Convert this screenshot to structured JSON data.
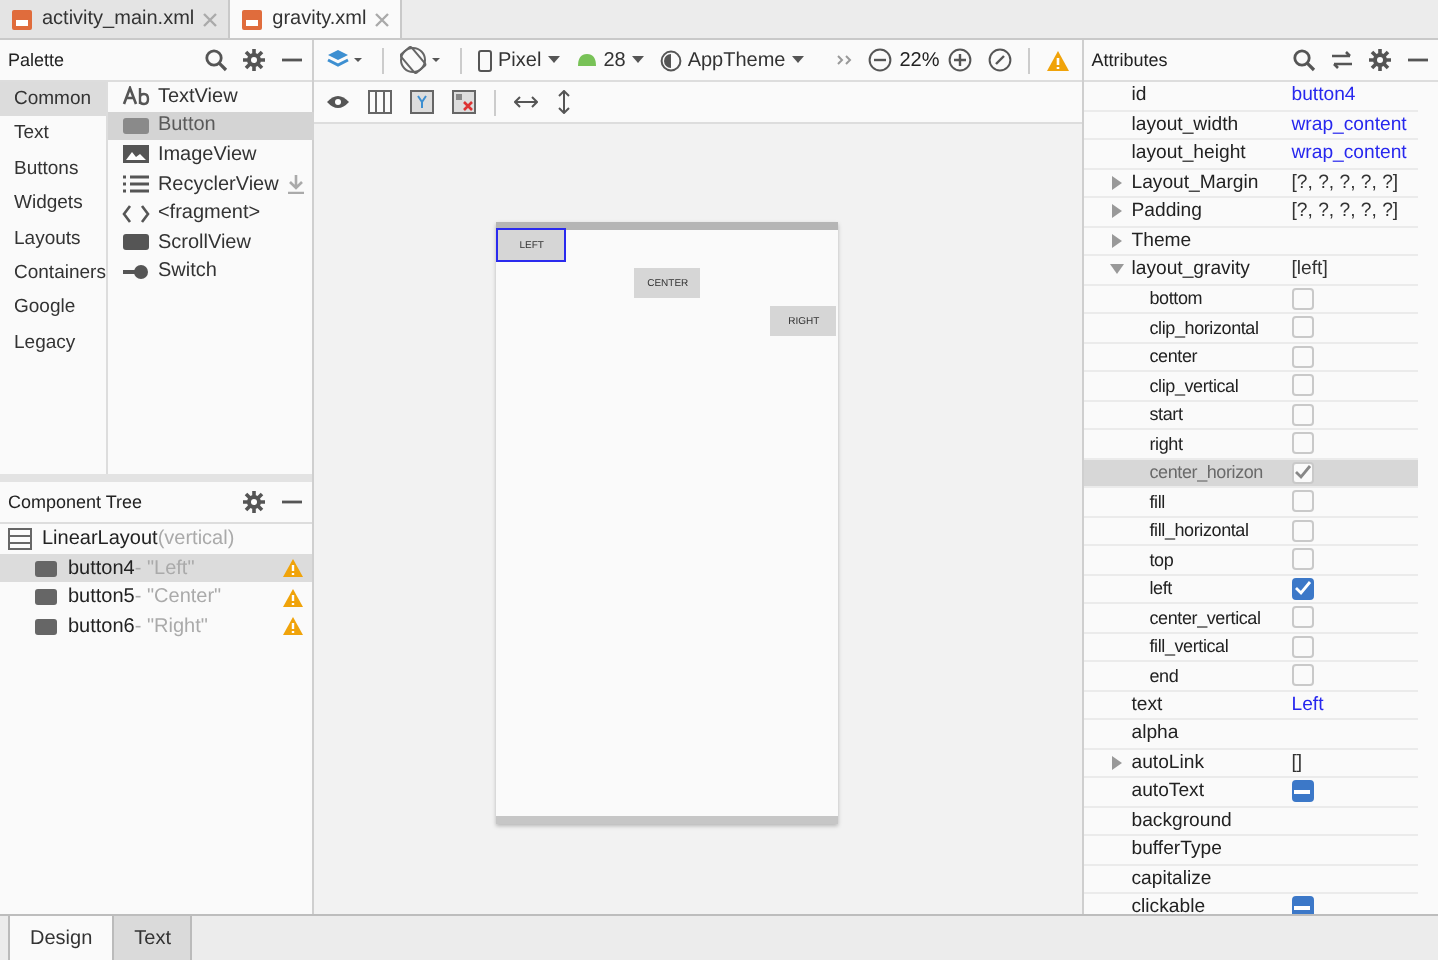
{
  "editor_tabs": [
    {
      "label": "activity_main.xml",
      "selected": false
    },
    {
      "label": "gravity.xml",
      "selected": true
    }
  ],
  "palette": {
    "title": "Palette",
    "categories": [
      {
        "label": "Common",
        "selected": true
      },
      {
        "label": "Text",
        "selected": false
      },
      {
        "label": "Buttons",
        "selected": false
      },
      {
        "label": "Widgets",
        "selected": false
      },
      {
        "label": "Layouts",
        "selected": false
      },
      {
        "label": "Containers",
        "selected": false
      },
      {
        "label": "Google",
        "selected": false
      },
      {
        "label": "Legacy",
        "selected": false
      }
    ],
    "items": [
      {
        "label": "TextView",
        "kind": "ab",
        "selected": false,
        "download": false
      },
      {
        "label": "Button",
        "kind": "button",
        "selected": true,
        "download": false
      },
      {
        "label": "ImageView",
        "kind": "image",
        "selected": false,
        "download": false
      },
      {
        "label": "RecyclerView",
        "kind": "list",
        "selected": false,
        "download": true
      },
      {
        "label": "<fragment>",
        "kind": "code",
        "selected": false,
        "download": false
      },
      {
        "label": "ScrollView",
        "kind": "button",
        "selected": false,
        "download": false
      },
      {
        "label": "Switch",
        "kind": "switch",
        "selected": false,
        "download": false
      }
    ]
  },
  "component_tree": {
    "title": "Component Tree",
    "root": {
      "label": "LinearLayout",
      "note": "(vertical)",
      "children": [
        {
          "label": "button4",
          "note": "- \"Left\"",
          "warning": true,
          "selected": true
        },
        {
          "label": "button5",
          "note": "- \"Center\"",
          "warning": true,
          "selected": false
        },
        {
          "label": "button6",
          "note": "- \"Right\"",
          "warning": true,
          "selected": false
        }
      ]
    }
  },
  "toolbar": {
    "device": "Pixel",
    "api": "28",
    "theme": "AppTheme",
    "zoom": "22%",
    "warning": true
  },
  "canvas": {
    "buttons": [
      {
        "label": "LEFT",
        "kind": "left",
        "selected": true
      },
      {
        "label": "CENTER",
        "kind": "center",
        "selected": false
      },
      {
        "label": "RIGHT",
        "kind": "right",
        "selected": false
      }
    ]
  },
  "attributes": {
    "title": "Attributes",
    "rows": [
      {
        "kind": "value",
        "name": "id",
        "value": "button4",
        "link": true,
        "selected": false
      },
      {
        "kind": "value",
        "name": "layout_width",
        "value": "wrap_content",
        "link": true,
        "selected": false
      },
      {
        "kind": "value",
        "name": "layout_height",
        "value": "wrap_content",
        "link": true,
        "selected": false
      },
      {
        "kind": "group",
        "name": "Layout_Margin",
        "value": "[?, ?, ?, ?, ?]",
        "expanded": false,
        "selected": false
      },
      {
        "kind": "group",
        "name": "Padding",
        "value": "[?, ?, ?, ?, ?]",
        "expanded": false,
        "selected": false
      },
      {
        "kind": "group",
        "name": "Theme",
        "expanded": false,
        "selected": false
      },
      {
        "kind": "group",
        "name": "layout_gravity",
        "value": "[left]",
        "expanded": true,
        "selected": false,
        "children": [
          {
            "kind": "flag",
            "name": "bottom",
            "checked": false,
            "selected": false
          },
          {
            "kind": "flag",
            "name": "clip_horizontal",
            "checked": false,
            "selected": false
          },
          {
            "kind": "flag",
            "name": "center",
            "checked": false,
            "selected": false
          },
          {
            "kind": "flag",
            "name": "clip_vertical",
            "checked": false,
            "selected": false
          },
          {
            "kind": "flag",
            "name": "start",
            "checked": false,
            "selected": false
          },
          {
            "kind": "flag",
            "name": "right",
            "checked": false,
            "selected": false
          },
          {
            "kind": "flag",
            "name": "center_horizon",
            "checked": true,
            "selected": true
          },
          {
            "kind": "flag",
            "name": "fill",
            "checked": false,
            "selected": false
          },
          {
            "kind": "flag",
            "name": "fill_horizontal",
            "checked": false,
            "selected": false
          },
          {
            "kind": "flag",
            "name": "top",
            "checked": false,
            "selected": false
          },
          {
            "kind": "flag",
            "name": "left",
            "checked": true,
            "selected": false
          },
          {
            "kind": "flag",
            "name": "center_vertical",
            "checked": false,
            "selected": false
          },
          {
            "kind": "flag",
            "name": "fill_vertical",
            "checked": false,
            "selected": false
          },
          {
            "kind": "flag",
            "name": "end",
            "checked": false,
            "selected": false
          }
        ]
      },
      {
        "kind": "value",
        "name": "text",
        "value": "Left",
        "link": true,
        "selected": false
      },
      {
        "kind": "value",
        "name": "alpha",
        "selected": false
      },
      {
        "kind": "group",
        "name": "autoLink",
        "value": "[]",
        "expanded": false,
        "selected": false
      },
      {
        "kind": "tristate",
        "name": "autoText",
        "mixed": true,
        "selected": false
      },
      {
        "kind": "value",
        "name": "background",
        "selected": false
      },
      {
        "kind": "value",
        "name": "bufferType",
        "selected": false
      },
      {
        "kind": "value",
        "name": "capitalize",
        "selected": false
      },
      {
        "kind": "tristate",
        "name": "clickable",
        "mixed": true,
        "selected": false
      }
    ]
  },
  "bottom_tabs": [
    {
      "label": "Design",
      "selected": true
    },
    {
      "label": "Text",
      "selected": false
    }
  ]
}
